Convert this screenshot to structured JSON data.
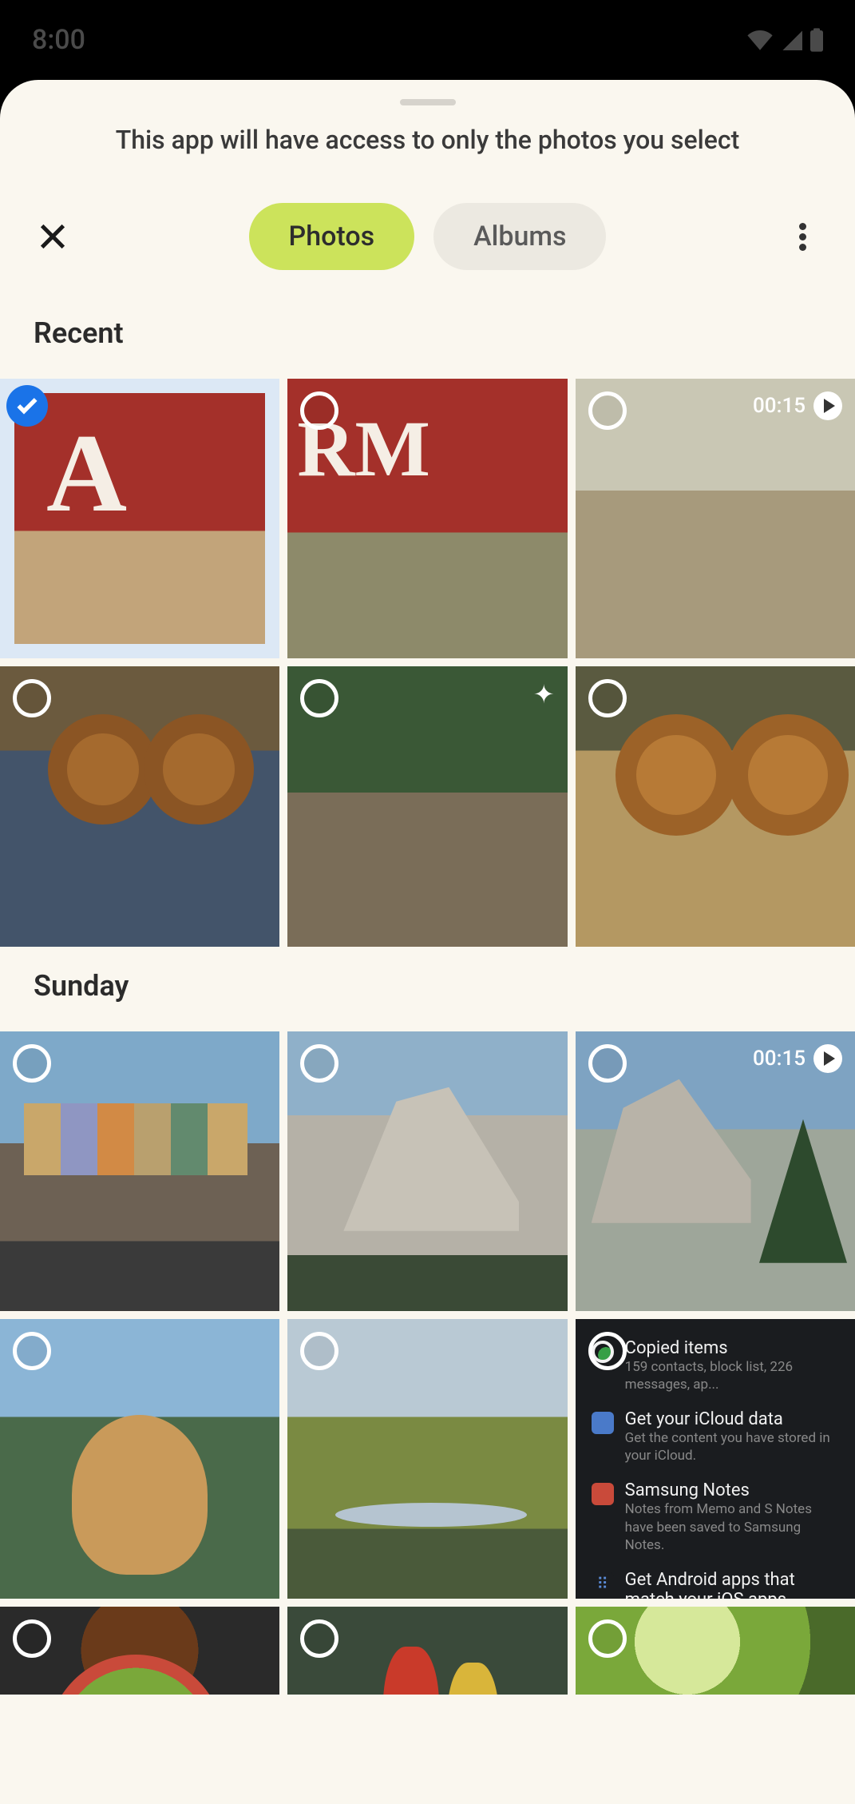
{
  "status": {
    "time": "8:00"
  },
  "sheet": {
    "access_message": "This app will have access to only the photos you select",
    "tabs": {
      "photos": "Photos",
      "albums": "Albums",
      "active": "photos"
    }
  },
  "sections": [
    {
      "title": "Recent",
      "items": [
        {
          "id": "recent-0",
          "selected": true,
          "video": false,
          "desc": "kids-farm-letter-a"
        },
        {
          "id": "recent-1",
          "selected": false,
          "video": false,
          "desc": "kids-running-barn-rm"
        },
        {
          "id": "recent-2",
          "selected": false,
          "video": true,
          "duration": "00:15",
          "desc": "kids-wagon-outdoor"
        },
        {
          "id": "recent-3",
          "selected": false,
          "video": false,
          "desc": "boy-donuts-eyes"
        },
        {
          "id": "recent-4",
          "selected": false,
          "video": false,
          "sparkle": true,
          "desc": "kids-eating-apples"
        },
        {
          "id": "recent-5",
          "selected": false,
          "video": false,
          "desc": "girl-donuts-eyes"
        }
      ]
    },
    {
      "title": "Sunday",
      "items": [
        {
          "id": "sun-0",
          "selected": false,
          "video": false,
          "desc": "painted-ladies-sf"
        },
        {
          "id": "sun-1",
          "selected": false,
          "video": false,
          "desc": "half-dome-yosemite"
        },
        {
          "id": "sun-2",
          "selected": false,
          "video": true,
          "duration": "00:15",
          "desc": "half-dome-trees"
        },
        {
          "id": "sun-3",
          "selected": false,
          "video": false,
          "desc": "golden-retriever-mountains"
        },
        {
          "id": "sun-4",
          "selected": false,
          "video": false,
          "desc": "grassland-pond-bison"
        },
        {
          "id": "sun-5",
          "selected": false,
          "video": false,
          "desc": "notifications-screenshot",
          "notifications": [
            {
              "icon": "green",
              "title": "Copied items",
              "sub": "159 contacts, block list, 226 messages, ap..."
            },
            {
              "icon": "blue",
              "title": "Get your iCloud data",
              "sub": "Get the content you have stored in your iCloud."
            },
            {
              "icon": "red",
              "title": "Samsung Notes",
              "sub": "Notes from Memo and S Notes have been saved to Samsung Notes."
            },
            {
              "icon": "dots",
              "title": "Get Android apps that match your iOS apps.",
              "sub": ""
            }
          ]
        },
        {
          "id": "sun-6",
          "selected": false,
          "video": false,
          "desc": "salad-bowl",
          "partial": true
        },
        {
          "id": "sun-7",
          "selected": false,
          "video": false,
          "desc": "bell-peppers",
          "partial": true
        },
        {
          "id": "sun-8",
          "selected": false,
          "video": false,
          "desc": "green-bokeh",
          "partial": true
        }
      ]
    }
  ]
}
